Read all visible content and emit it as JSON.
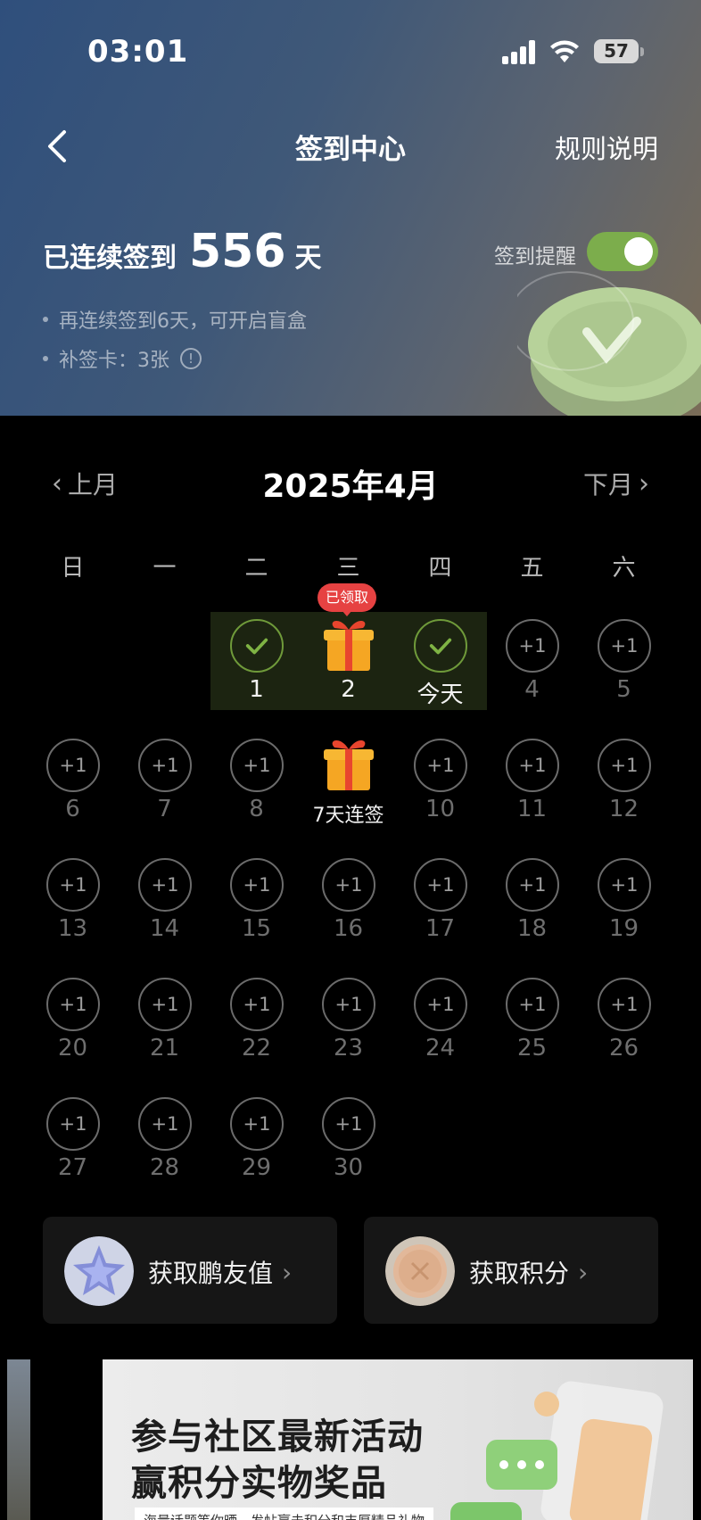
{
  "status_bar": {
    "time": "03:01",
    "battery": "57"
  },
  "nav": {
    "title": "签到中心",
    "rules": "规则说明"
  },
  "streak": {
    "label": "已连续签到",
    "days": "556",
    "unit": "天"
  },
  "tips": [
    "再连续签到6天，可开启盲盒",
    "补签卡：3张"
  ],
  "reminder": {
    "label": "签到提醒",
    "enabled": true
  },
  "calendar": {
    "title": "2025年4月",
    "prev": "上月",
    "next": "下月",
    "weekdays": [
      "日",
      "一",
      "二",
      "三",
      "四",
      "五",
      "六"
    ],
    "claimed_badge": "已领取",
    "plus_label": "+1",
    "days": [
      {
        "label": "1",
        "state": "checked",
        "col": 2,
        "row": 0
      },
      {
        "label": "2",
        "state": "gift",
        "col": 3,
        "row": 0
      },
      {
        "label": "今天",
        "state": "checked",
        "col": 4,
        "row": 0
      },
      {
        "label": "4",
        "state": "plus",
        "col": 5,
        "row": 0
      },
      {
        "label": "5",
        "state": "plus",
        "col": 6,
        "row": 0
      },
      {
        "label": "6",
        "state": "plus",
        "col": 0,
        "row": 1
      },
      {
        "label": "7",
        "state": "plus",
        "col": 1,
        "row": 1
      },
      {
        "label": "8",
        "state": "plus",
        "col": 2,
        "row": 1
      },
      {
        "label": "7天连签",
        "state": "gift",
        "col": 3,
        "row": 1
      },
      {
        "label": "10",
        "state": "plus",
        "col": 4,
        "row": 1
      },
      {
        "label": "11",
        "state": "plus",
        "col": 5,
        "row": 1
      },
      {
        "label": "12",
        "state": "plus",
        "col": 6,
        "row": 1
      },
      {
        "label": "13",
        "state": "plus",
        "col": 0,
        "row": 2
      },
      {
        "label": "14",
        "state": "plus",
        "col": 1,
        "row": 2
      },
      {
        "label": "15",
        "state": "plus",
        "col": 2,
        "row": 2
      },
      {
        "label": "16",
        "state": "plus",
        "col": 3,
        "row": 2
      },
      {
        "label": "17",
        "state": "plus",
        "col": 4,
        "row": 2
      },
      {
        "label": "18",
        "state": "plus",
        "col": 5,
        "row": 2
      },
      {
        "label": "19",
        "state": "plus",
        "col": 6,
        "row": 2
      },
      {
        "label": "20",
        "state": "plus",
        "col": 0,
        "row": 3
      },
      {
        "label": "21",
        "state": "plus",
        "col": 1,
        "row": 3
      },
      {
        "label": "22",
        "state": "plus",
        "col": 2,
        "row": 3
      },
      {
        "label": "23",
        "state": "plus",
        "col": 3,
        "row": 3
      },
      {
        "label": "24",
        "state": "plus",
        "col": 4,
        "row": 3
      },
      {
        "label": "25",
        "state": "plus",
        "col": 5,
        "row": 3
      },
      {
        "label": "26",
        "state": "plus",
        "col": 6,
        "row": 3
      },
      {
        "label": "27",
        "state": "plus",
        "col": 0,
        "row": 4
      },
      {
        "label": "28",
        "state": "plus",
        "col": 1,
        "row": 4
      },
      {
        "label": "29",
        "state": "plus",
        "col": 2,
        "row": 4
      },
      {
        "label": "30",
        "state": "plus",
        "col": 3,
        "row": 4
      }
    ]
  },
  "cards": [
    {
      "label": "获取鹏友值",
      "icon": "star-badge-icon"
    },
    {
      "label": "获取积分",
      "icon": "points-coin-icon"
    }
  ],
  "banner": {
    "line1": "参与社区最新活动",
    "line2": "赢积分实物奖品",
    "sub": "海量话题等你晒，发帖赢击积分和丰厚精品礼物"
  },
  "colors": {
    "accent_green": "#7cad4c",
    "badge_red": "#e64242",
    "gift_orange": "#f5a623"
  }
}
